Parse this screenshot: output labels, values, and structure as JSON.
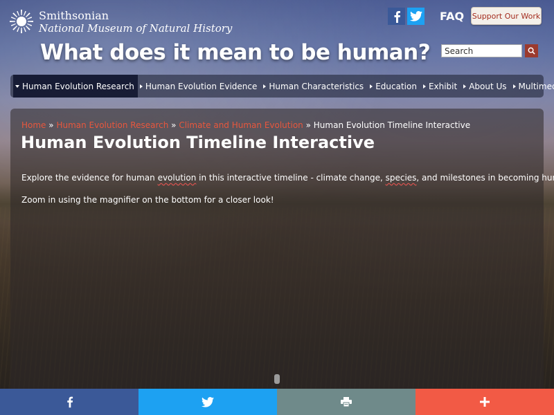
{
  "header": {
    "org": "Smithsonian",
    "museum": "National Museum of Natural History",
    "site_title": "What does it mean to be human?",
    "faq": "FAQ",
    "support": "Support Our Work",
    "search_placeholder": "Search",
    "social_icons": [
      "facebook-icon",
      "twitter-icon"
    ]
  },
  "nav": {
    "items": [
      {
        "label": "Human Evolution Research",
        "active": true
      },
      {
        "label": "Human Evolution Evidence"
      },
      {
        "label": "Human Characteristics"
      },
      {
        "label": "Education"
      },
      {
        "label": "Exhibit"
      },
      {
        "label": "About Us"
      },
      {
        "label": "Multimedia"
      }
    ]
  },
  "breadcrumb": {
    "items": [
      "Home",
      "Human Evolution Research",
      "Climate and Human Evolution"
    ],
    "separator": "»",
    "current": "Human Evolution Timeline Interactive"
  },
  "page": {
    "title": "Human Evolution Timeline Interactive",
    "intro_a": "Explore the evidence for human ",
    "intro_word1": "evolution",
    "intro_b": " in this interactive timeline - climate change, ",
    "intro_word2": "species",
    "intro_c": ", and milestones in becoming human.",
    "zoom_hint": "Zoom in using the magnifier on the bottom for a closer look!"
  },
  "share": {
    "buttons": [
      "facebook-icon",
      "twitter-icon",
      "print-icon",
      "plus-icon"
    ]
  },
  "colors": {
    "facebook": "#3b5998",
    "twitter": "#1da1f2",
    "print": "#6f8a8a",
    "more": "#f25a45",
    "link": "#e8573d",
    "support_text": "#a32b1e"
  }
}
